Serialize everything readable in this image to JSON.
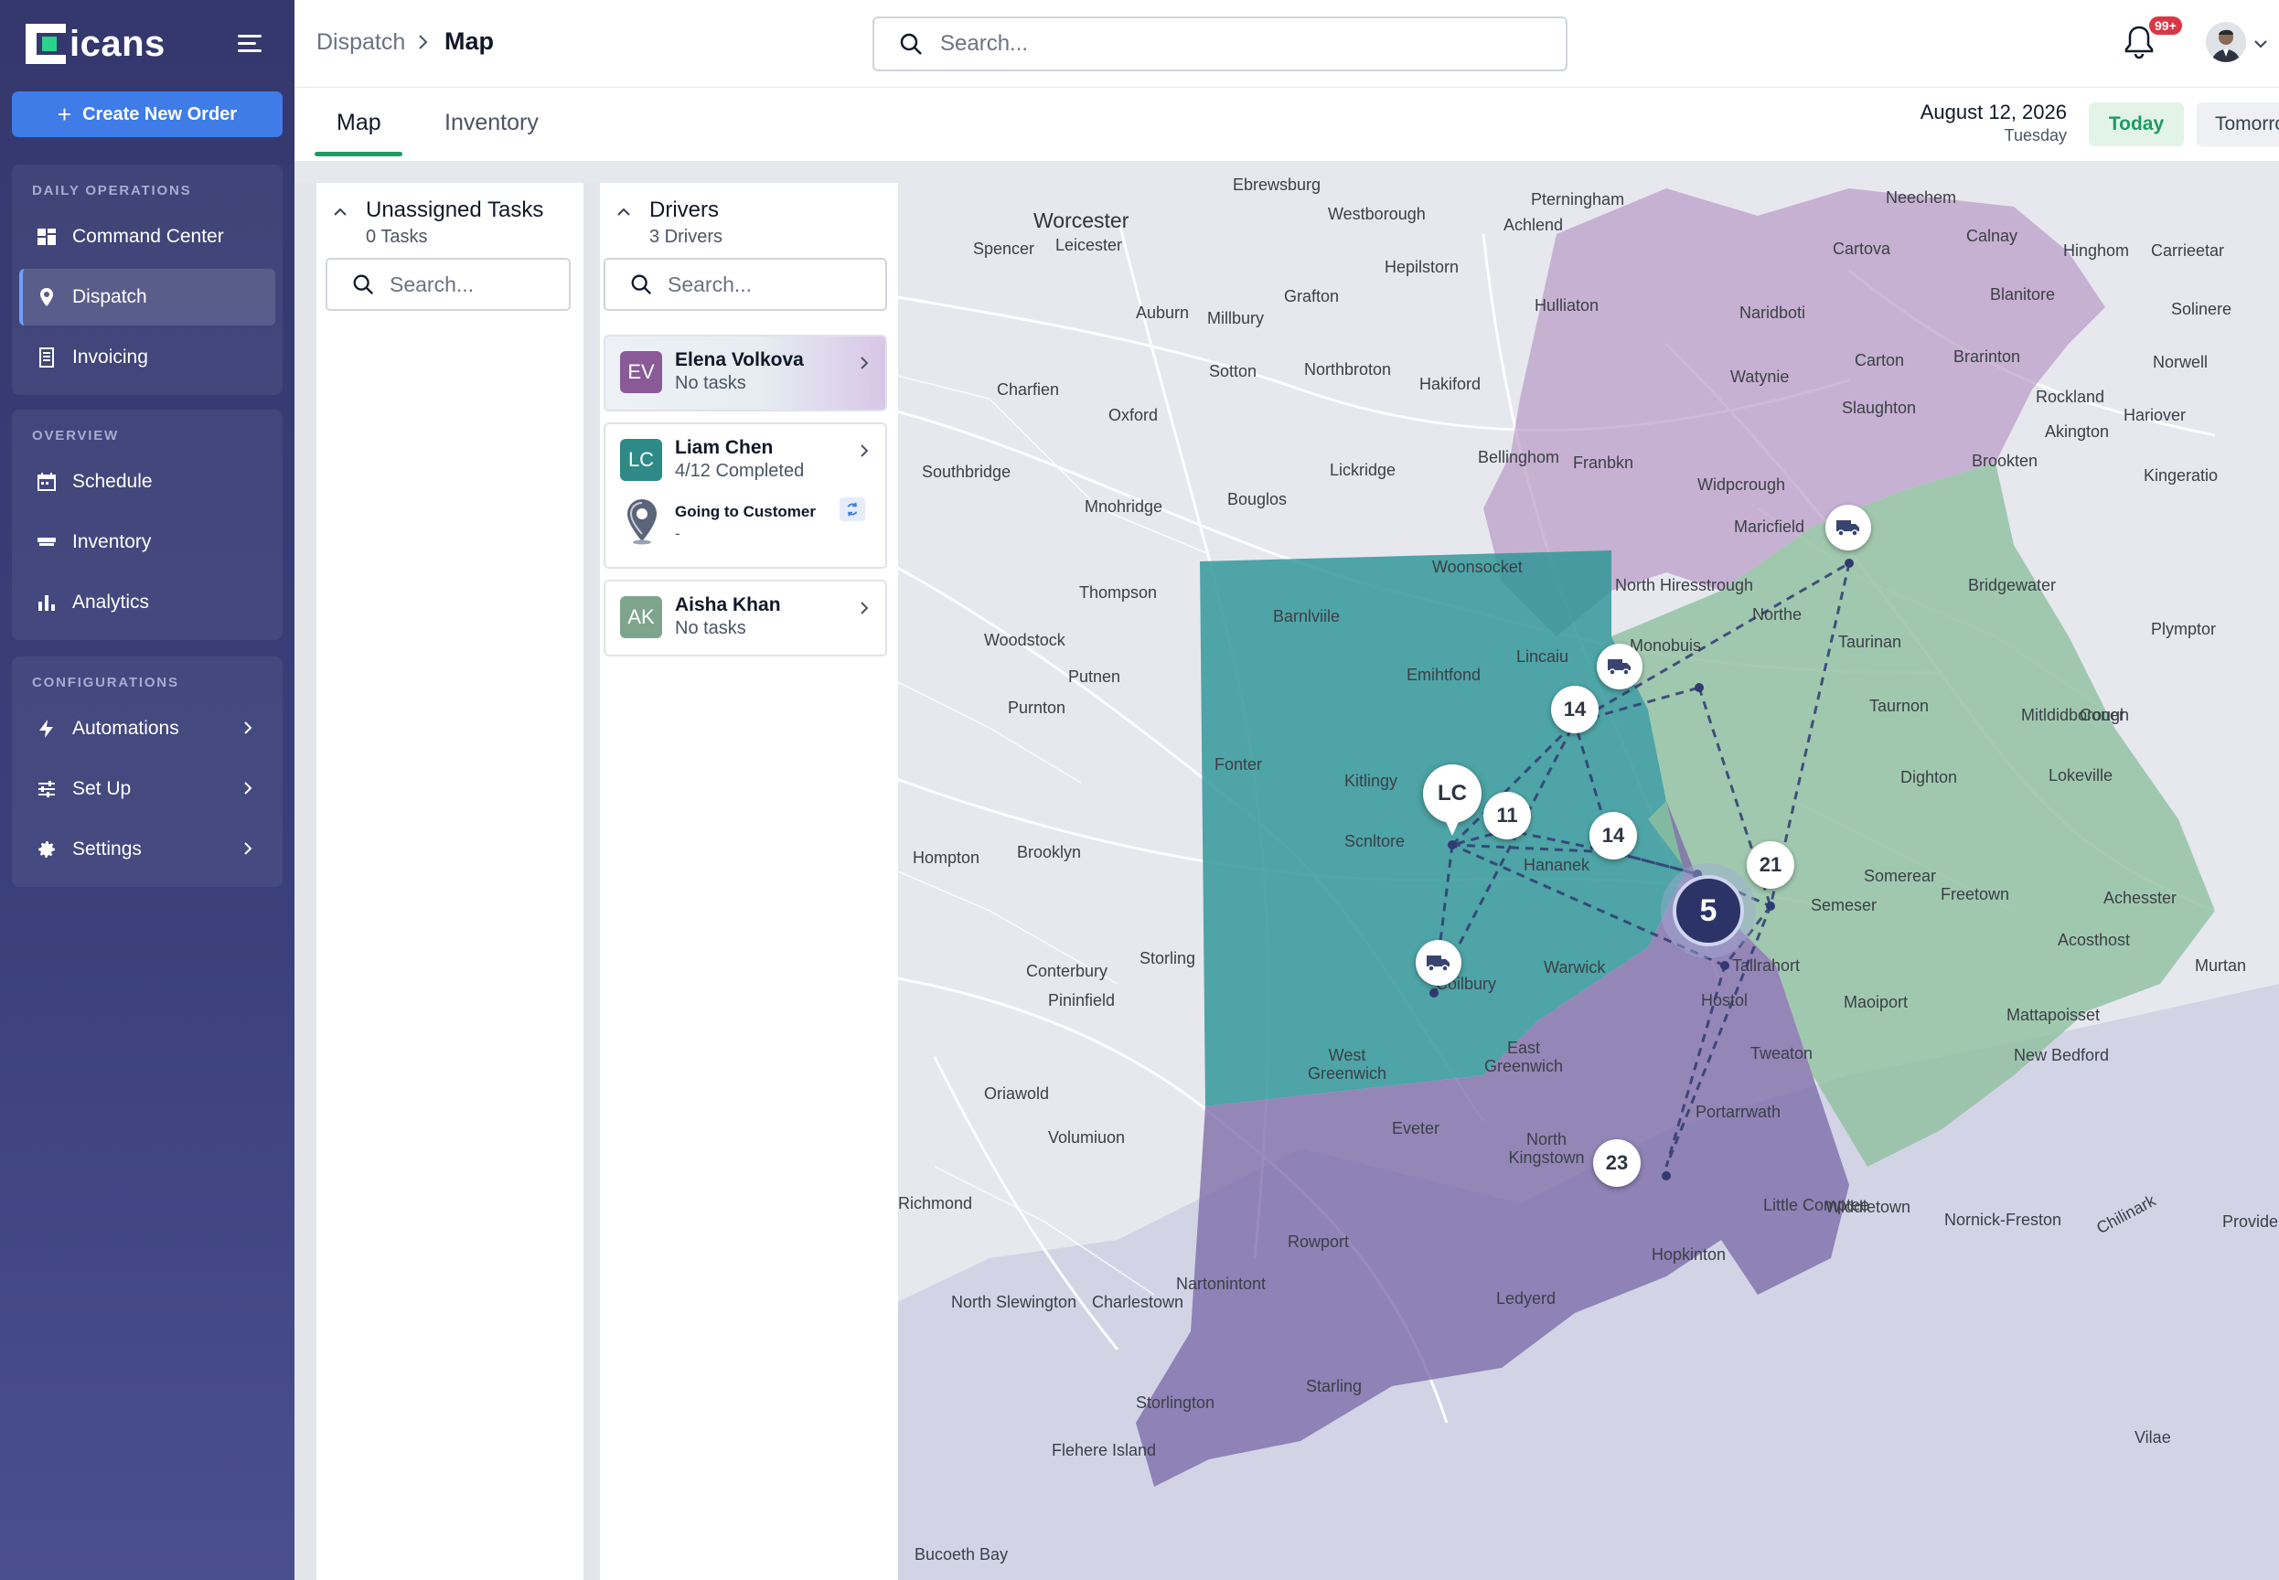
{
  "app": {
    "logo_text": "icans",
    "create_button": "Create New Order"
  },
  "sidebar": {
    "groups": [
      {
        "label": "DAILY OPERATIONS",
        "items": [
          {
            "label": "Command Center",
            "icon": "dashboard-icon"
          },
          {
            "label": "Dispatch",
            "icon": "location-pin-icon",
            "active": true
          },
          {
            "label": "Invoicing",
            "icon": "invoice-icon"
          }
        ]
      },
      {
        "label": "OVERVIEW",
        "items": [
          {
            "label": "Schedule",
            "icon": "calendar-icon"
          },
          {
            "label": "Inventory",
            "icon": "inventory-icon"
          },
          {
            "label": "Analytics",
            "icon": "bar-chart-icon"
          }
        ]
      },
      {
        "label": "CONFIGURATIONS",
        "items": [
          {
            "label": "Automations",
            "icon": "lightning-icon"
          },
          {
            "label": "Set Up",
            "icon": "sliders-icon"
          },
          {
            "label": "Settings",
            "icon": "gear-icon"
          }
        ]
      }
    ]
  },
  "header": {
    "breadcrumb_parent": "Dispatch",
    "breadcrumb_current": "Map",
    "search_placeholder": "Search...",
    "notification_badge": "99+"
  },
  "tabs": [
    {
      "label": "Map",
      "active": true
    },
    {
      "label": "Inventory",
      "active": false
    }
  ],
  "date": {
    "main": "August 12, 2026",
    "weekday": "Tuesday",
    "today_label": "Today",
    "tomorrow_label": "Tomorrow"
  },
  "tasks_panel": {
    "title": "Unassigned Tasks",
    "subtitle": "0 Tasks",
    "search_placeholder": "Search..."
  },
  "drivers_panel": {
    "title": "Drivers",
    "subtitle": "3 Drivers",
    "search_placeholder": "Search...",
    "drivers": [
      {
        "initials": "EV",
        "name": "Elena Volkova",
        "status": "No tasks",
        "color": "#8a5a98"
      },
      {
        "initials": "LC",
        "name": "Liam Chen",
        "status": "4/12 Completed",
        "color": "#2e8a87",
        "activity": "Going to Customer",
        "activity_detail": "-"
      },
      {
        "initials": "AK",
        "name": "Aisha Khan",
        "status": "No tasks",
        "color": "#7ea58c"
      }
    ]
  },
  "map": {
    "clusters": [
      "14",
      "11",
      "14",
      "21",
      "23"
    ],
    "focus_cluster": "5",
    "driver_pin": "LC",
    "zone_colors": {
      "teal": "#2c9596",
      "purple": "#7c6aa8",
      "green": "#8fbf9f",
      "pink": "#b08cc0"
    },
    "towns": [
      {
        "name": "Worcester",
        "large": true
      },
      {
        "name": "Ebrewsburg"
      },
      {
        "name": "Westborough"
      },
      {
        "name": "Spencer"
      },
      {
        "name": "Leicester"
      },
      {
        "name": "Auburn"
      },
      {
        "name": "Millbury"
      },
      {
        "name": "Grafton"
      },
      {
        "name": "Hepilstorn"
      },
      {
        "name": "Hulliaton"
      },
      {
        "name": "Naridboti"
      },
      {
        "name": "Cartova"
      },
      {
        "name": "Calnay"
      },
      {
        "name": "Hinghom"
      },
      {
        "name": "Carrieetar"
      },
      {
        "name": "Solinere"
      },
      {
        "name": "Neechem"
      },
      {
        "name": "Pterningham"
      },
      {
        "name": "Achlend"
      },
      {
        "name": "Charfien"
      },
      {
        "name": "Sotton"
      },
      {
        "name": "Northbroton"
      },
      {
        "name": "Hakiford"
      },
      {
        "name": "Oxford"
      },
      {
        "name": "Southbridge"
      },
      {
        "name": "Lickridge"
      },
      {
        "name": "Mnohridge"
      },
      {
        "name": "Bouglos"
      },
      {
        "name": "Bellinghom"
      },
      {
        "name": "Franbkn"
      },
      {
        "name": "Watynie"
      },
      {
        "name": "Carton"
      },
      {
        "name": "Brarinton"
      },
      {
        "name": "Blanitore"
      },
      {
        "name": "Norwell"
      },
      {
        "name": "Slaughton"
      },
      {
        "name": "Rockland"
      },
      {
        "name": "Akington"
      },
      {
        "name": "Hariover"
      },
      {
        "name": "Widpcrough"
      },
      {
        "name": "Brookten"
      },
      {
        "name": "Kingeratio"
      },
      {
        "name": "Maricfield"
      },
      {
        "name": "Thompson"
      },
      {
        "name": "Woonsocket"
      },
      {
        "name": "Barnlviile"
      },
      {
        "name": "North Hiresstrough"
      },
      {
        "name": "Bridgewater"
      },
      {
        "name": "Plymptor"
      },
      {
        "name": "Woodstock"
      },
      {
        "name": "Putnen"
      },
      {
        "name": "Emihtfond"
      },
      {
        "name": "Lincaiu"
      },
      {
        "name": "Monobuis"
      },
      {
        "name": "Taurinan"
      },
      {
        "name": "Northe"
      },
      {
        "name": "Taurnon"
      },
      {
        "name": "Mitldidborough"
      },
      {
        "name": "Coner"
      },
      {
        "name": "Purnton"
      },
      {
        "name": "Fonter"
      },
      {
        "name": "Kitlingy"
      },
      {
        "name": "Dighton"
      },
      {
        "name": "Lokeville"
      },
      {
        "name": "Hompton"
      },
      {
        "name": "Brooklyn"
      },
      {
        "name": "Scnltore"
      },
      {
        "name": "Hananek"
      },
      {
        "name": "Somerear"
      },
      {
        "name": "Freetown"
      },
      {
        "name": "Semeser"
      },
      {
        "name": "Achesster"
      },
      {
        "name": "Storling"
      },
      {
        "name": "Conterbury"
      },
      {
        "name": "Coilbury"
      },
      {
        "name": "Warwick"
      },
      {
        "name": "Tallrahort"
      },
      {
        "name": "Acosthost"
      },
      {
        "name": "Murtan"
      },
      {
        "name": "Maoiport"
      },
      {
        "name": "Hostol"
      },
      {
        "name": "Pininfield"
      },
      {
        "name": "West Greenwich"
      },
      {
        "name": "East Greenwich"
      },
      {
        "name": "Tweaton"
      },
      {
        "name": "Mattapoisset"
      },
      {
        "name": "New Bedford"
      },
      {
        "name": "Oriawold"
      },
      {
        "name": "Volumiuon"
      },
      {
        "name": "Eveter"
      },
      {
        "name": "North Kingstown"
      },
      {
        "name": "Portarrwath"
      },
      {
        "name": "Widdletown"
      },
      {
        "name": "Little Comptee"
      },
      {
        "name": "Nornick-Freston"
      },
      {
        "name": "Richmond"
      },
      {
        "name": "Rowport"
      },
      {
        "name": "Hopkinton"
      },
      {
        "name": "Nartonintont"
      },
      {
        "name": "Ledyerd"
      },
      {
        "name": "North Slewington"
      },
      {
        "name": "Charlestown"
      },
      {
        "name": "Starling"
      },
      {
        "name": "Storlington"
      },
      {
        "name": "Flehere Island"
      },
      {
        "name": "Bucoeth Bay"
      },
      {
        "name": "Chilinark"
      },
      {
        "name": "Vilae"
      },
      {
        "name": "Providence",
        "large": true
      }
    ]
  }
}
